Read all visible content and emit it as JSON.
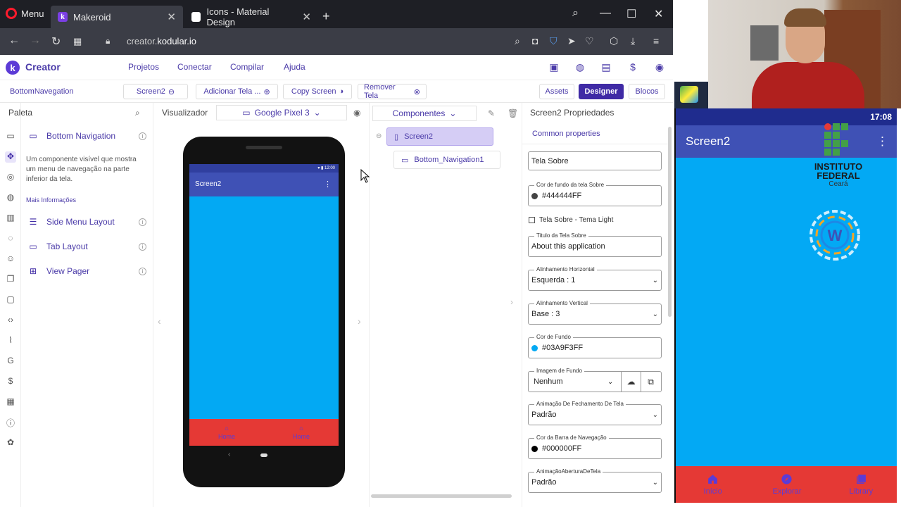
{
  "browser": {
    "menu_label": "Menu",
    "tabs": [
      {
        "title": "Makeroid",
        "favicon": "k"
      },
      {
        "title": "Icons - Material Design",
        "favicon": ""
      }
    ],
    "url_prefix": "creator.",
    "url_domain": "kodular.io"
  },
  "kodular": {
    "brand": "Creator",
    "menu": [
      "Projetos",
      "Conectar",
      "Compilar",
      "Ajuda"
    ]
  },
  "toolbar": {
    "project": "BottomNavegation",
    "screen": "Screen2",
    "add_screen": "Adicionar Tela ...",
    "copy_screen": "Copy Screen",
    "remove_screen": "Remover Tela",
    "assets": "Assets",
    "designer": "Designer",
    "blocks": "Blocos"
  },
  "palette": {
    "title": "Paleta",
    "items": [
      {
        "label": "Bottom Navigation",
        "icon": "bottom-navigation-icon"
      },
      {
        "label": "Side Menu Layout",
        "icon": "list-icon"
      },
      {
        "label": "Tab Layout",
        "icon": "tab-icon"
      },
      {
        "label": "View Pager",
        "icon": "view-pager-icon"
      }
    ],
    "description": "Um componente visível que mostra um menu de navegação na parte inferior da tela.",
    "more_info": "Mais Informações"
  },
  "viewer": {
    "title": "Visualizador",
    "device": "Google Pixel 3",
    "phone": {
      "status_time": "12:00",
      "screen_title": "Screen2",
      "nav_items": [
        "Home",
        "Home"
      ]
    }
  },
  "components": {
    "title": "Componentes",
    "tree": [
      {
        "label": "Screen2"
      },
      {
        "label": "Bottom_Navigation1"
      }
    ]
  },
  "properties": {
    "title": "Screen2 Propriedades",
    "common": "Common properties",
    "about_screen": "Tela Sobre",
    "about_bg_label": "Cor de fundo da tela Sobre",
    "about_bg_value": "#444444FF",
    "about_light_label": "Tela Sobre - Tema Light",
    "about_title_label": "Titulo da Tela Sobre",
    "about_title_value": "About this application",
    "h_align_label": "Alinhamento Horizontal",
    "h_align_value": "Esquerda : 1",
    "v_align_label": "Alinhamento Vertical",
    "v_align_value": "Base : 3",
    "bg_color_label": "Cor de Fundo",
    "bg_color_value": "#03A9F3FF",
    "bg_image_label": "Imagem de Fundo",
    "bg_image_value": "Nenhum",
    "close_anim_label": "Animação De Fechamento De Tela",
    "close_anim_value": "Padrão",
    "navbar_color_label": "Cor da Barra de Navegação",
    "navbar_color_value": "#000000FF",
    "open_anim_label": "AnimaçãoAberturaDeTela",
    "open_anim_value": "Padrão"
  },
  "emulator": {
    "time": "17:08",
    "title": "Screen2",
    "institute_line1": "INSTITUTO",
    "institute_line2": "FEDERAL",
    "institute_line3": "Ceará",
    "nav_items": [
      "Início",
      "Explorar",
      "Library"
    ]
  },
  "colors": {
    "screen_bg": "#03A9F3",
    "bottom_nav": "#E53935",
    "accent": "#3F2AA5"
  }
}
